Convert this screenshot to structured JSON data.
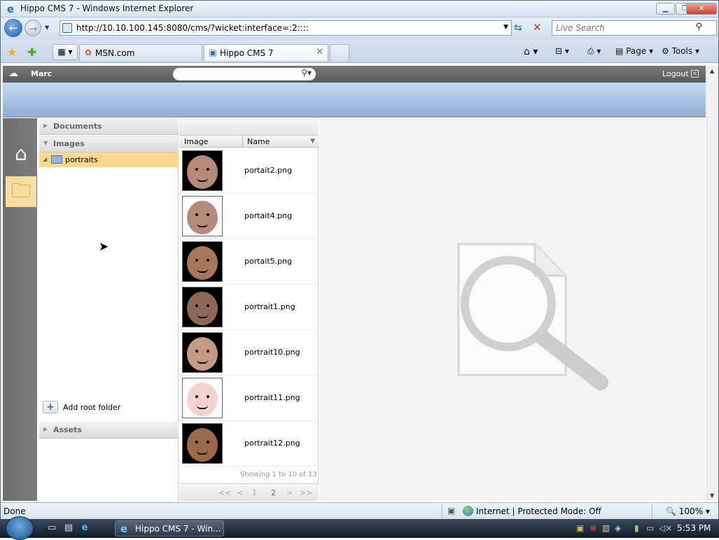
{
  "window": {
    "title": "Hippo CMS 7 - Windows Internet Explorer"
  },
  "address_bar": {
    "url": "http://10.10.100.145:8080/cms/?wicket:interface=:2::::",
    "search_placeholder": "Live Search"
  },
  "tabs": [
    {
      "label": "MSN.com",
      "active": false
    },
    {
      "label": "Hippo CMS 7",
      "active": true
    }
  ],
  "command_bar": {
    "page": "Page",
    "tools": "Tools"
  },
  "cms": {
    "user": "Marc",
    "logout": "Logout",
    "sections": {
      "documents": "Documents",
      "images": "Images",
      "assets": "Assets"
    },
    "folder": "portraits",
    "add_root_folder": "Add root folder",
    "list_headers": {
      "image": "Image",
      "name": "Name"
    },
    "items": [
      {
        "name": "portait2.png",
        "skin": "#b58a7a"
      },
      {
        "name": "portait4.png",
        "skin": "#b58a7a"
      },
      {
        "name": "portait5.png",
        "skin": "#a8775a"
      },
      {
        "name": "portrait1.png",
        "skin": "#8e6857"
      },
      {
        "name": "portrait10.png",
        "skin": "#c49a86"
      },
      {
        "name": "portrait11.png",
        "skin": "#f3d3cc"
      },
      {
        "name": "portrait12.png",
        "skin": "#9a6b4a"
      }
    ],
    "showing": "Showing 1 to 10 of 13",
    "pager": {
      "first": "<<",
      "prev": "<",
      "p1": "1",
      "p2": "2",
      "next": ">",
      "last": ">>"
    }
  },
  "status_bar": {
    "status": "Done",
    "zone": "Internet | Protected Mode: Off",
    "zoom": "100%"
  },
  "taskbar": {
    "task": "Hippo CMS 7 - Win...",
    "clock": "5:53 PM"
  },
  "colors": {
    "accent": "#fbd78b",
    "banner": "#a9c3e3",
    "topbar": "#6a6a6a"
  }
}
